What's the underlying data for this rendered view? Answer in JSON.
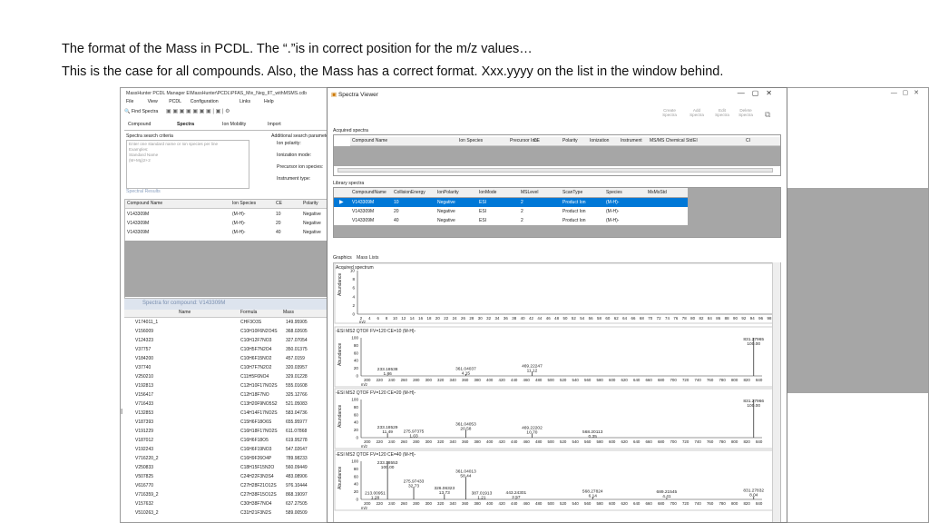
{
  "caption": {
    "line1": "The format of the Mass in PCDL. The “.”is in correct position for the m/z values…",
    "line2": "This is the case for all compounds. Also, the Mass has a correct format. Xxx.yyyy on the list in the window behind."
  },
  "back": {
    "title": "MassHunter PCDL Manager  E\\MassHunter\\PCDL\\PFAS_Mix_Neg_IIT_withMSMS.cdb",
    "menu": [
      "File",
      "View",
      "PCDL",
      "Configuration",
      "Links",
      "Help"
    ],
    "find_spectra": "Find Spectra",
    "tabs": [
      "Compound",
      "Spectra",
      "Ion Mobility",
      "Import"
    ],
    "criteria_title": "Spectra search criteria",
    "criteria_hint": [
      "Enter one standard name or Ion species per line",
      "Examples:",
      "Standard Name",
      "(M+Mg)2+2"
    ],
    "additional_title": "Additional search parameter",
    "params": [
      "Ion polarity:",
      "Ionization mode:",
      "Precursor ion species:",
      "Instrument type:"
    ],
    "results_title": "Spectral Results",
    "results_cols": [
      "Compound Name",
      "Ion Species",
      "CE",
      "Polarity"
    ],
    "results_rows": [
      [
        "V143309M",
        "(M-H)-",
        "10",
        "Negative"
      ],
      [
        "V143309M",
        "(M-H)-",
        "20",
        "Negative"
      ],
      [
        "V143309M",
        "(M-H)-",
        "40",
        "Negative"
      ]
    ],
    "compound_title": "Spectra for compound: V143309M",
    "list_cols": [
      "Name",
      "Formula",
      "Mass"
    ],
    "list_rows": [
      [
        "V174011_1",
        "CHF3O3S",
        "149.95905"
      ],
      [
        "V156009",
        "C10H10F6N2O4S",
        "368.02605"
      ],
      [
        "V124323",
        "C10H12F7NO3",
        "327.07054"
      ],
      [
        "V37757",
        "C10H5F7N2O4",
        "350.01375"
      ],
      [
        "V184200",
        "C10H6F15NO2",
        "457.0159"
      ],
      [
        "V37740",
        "C10H7F7N2O2",
        "320.03957"
      ],
      [
        "V250210",
        "C11H5F6NO4",
        "329.01228"
      ],
      [
        "V192813",
        "C12H10F17NO2S",
        "555.01608"
      ],
      [
        "V156417",
        "C12H18F7NO",
        "325.12766"
      ],
      [
        "V716433",
        "C13H20F9NO5S2",
        "521.05083"
      ],
      [
        "V132853",
        "C14H14F17NO2S",
        "583.04736"
      ],
      [
        "V187393",
        "C15H6F18O6S",
        "655.95977"
      ],
      [
        "V191229",
        "C16H18F17NO2S",
        "611.07868"
      ],
      [
        "V187012",
        "C16H6F18O5",
        "619.95278"
      ],
      [
        "V192243",
        "C16H6F19NO3",
        "547.02647"
      ],
      [
        "V716220_2",
        "C16H9F26O4P",
        "789.98233"
      ],
      [
        "V250833",
        "C18H15F15N2O",
        "560.09449"
      ],
      [
        "V507825",
        "C24H22F3N3S4",
        "483.08906"
      ],
      [
        "V616770",
        "C27H28F21O12S",
        "976.10444"
      ],
      [
        "V716359_2",
        "C27H38F15O12S",
        "868.19097"
      ],
      [
        "V157632",
        "C30H38F7NO4",
        "637.27505"
      ],
      [
        "V510263_2",
        "C31H21F3N2S",
        "589.00509"
      ]
    ]
  },
  "viewer": {
    "title": "Spectra Viewer",
    "toolbar": [
      "Create Spectra",
      "Add Spectra",
      "Edit Spectra",
      "Delete Spectra"
    ],
    "acquired_title": "Acquired spectra",
    "acquired_cols": [
      "Compound Name",
      "Ion Species",
      "Precursor Ion",
      "CE",
      "Polarity",
      "Ionization",
      "Instrument",
      "MS/MS Chemical Std",
      "EI",
      "CI"
    ],
    "library_title": "Library spectra",
    "library_cols": [
      "CompoundName",
      "CollisionEnergy",
      "IonPolarity",
      "IonMode",
      "MSLevel",
      "ScanType",
      "Species",
      "MsMsStd"
    ],
    "library_rows": [
      [
        "V143309M",
        "10",
        "Negative",
        "ESI",
        "2",
        "Product Ion",
        "(M-H)-"
      ],
      [
        "V143309M",
        "20",
        "Negative",
        "ESI",
        "2",
        "Product Ion",
        "(M-H)-"
      ],
      [
        "V143309M",
        "40",
        "Negative",
        "ESI",
        "2",
        "Product Ion",
        "(M-H)-"
      ]
    ],
    "graphics_tabs": [
      "Graphics",
      "Mass Lists"
    ],
    "acq_plot": {
      "label": "Acquired spectrum",
      "ylabel": "Abundance",
      "yticks": [
        "10",
        "8",
        "6",
        "4",
        "2",
        "0"
      ],
      "xticks": [
        "2",
        "4",
        "6",
        "8",
        "10",
        "12",
        "14",
        "16",
        "18",
        "20",
        "22",
        "24",
        "26",
        "28",
        "30",
        "32",
        "34",
        "36",
        "38",
        "40",
        "42",
        "44",
        "46",
        "48",
        "50",
        "52",
        "54",
        "56",
        "58",
        "60",
        "62",
        "64",
        "66",
        "68",
        "70",
        "72",
        "74",
        "76",
        "78",
        "80",
        "82",
        "84",
        "86",
        "88",
        "90",
        "92",
        "94",
        "96",
        "98"
      ],
      "xlabel": "m/z"
    },
    "spec_xticks": [
      "200",
      "220",
      "240",
      "260",
      "280",
      "300",
      "320",
      "340",
      "360",
      "380",
      "400",
      "420",
      "440",
      "460",
      "480",
      "500",
      "520",
      "540",
      "560",
      "580",
      "600",
      "620",
      "640",
      "660",
      "680",
      "700",
      "720",
      "740",
      "760",
      "780",
      "800",
      "820",
      "840"
    ],
    "spec_yticks": [
      "100",
      "80",
      "60",
      "40",
      "20",
      "0"
    ],
    "ylabel": "Abundance",
    "xlabel": "m/z",
    "panels": [
      {
        "title": "-ESI MS2 QTOF FV=120  CE=10 (M-H)-",
        "peaks": [
          [
            233.18538,
            1.86
          ],
          [
            361.04037,
            4.15
          ],
          [
            469.22247,
            11.12
          ],
          [
            831.27965,
            100
          ]
        ],
        "labels": [
          {
            "mz": "233.18538",
            "ab": "1.86"
          },
          {
            "mz": "361.04037",
            "ab": "4.15"
          },
          {
            "mz": "469.22247",
            "ab": "11.12"
          },
          {
            "mz": "831.27965",
            "ab": "100.00"
          }
        ]
      },
      {
        "title": "-ESI MS2 QTOF FV=120  CE=20 (M-H)-",
        "peaks": [
          [
            233.18529,
            11.49
          ],
          [
            275.97375,
            1.03
          ],
          [
            361.04053,
            20.58
          ],
          [
            469.22202,
            10.7
          ],
          [
            568.20113,
            0.35
          ],
          [
            831.27966,
            100
          ]
        ],
        "labels": [
          {
            "mz": "233.18529",
            "ab": "11.49"
          },
          {
            "mz": "275.97375",
            "ab": "1.03"
          },
          {
            "mz": "361.04053",
            "ab": "20.58"
          },
          {
            "mz": "469.22202",
            "ab": "10.70"
          },
          {
            "mz": "568.20113",
            "ab": "0.35"
          },
          {
            "mz": "831.27966",
            "ab": "100.00"
          }
        ]
      },
      {
        "title": "-ESI MS2 QTOF FV=120  CE=40 (M-H)-",
        "peaks": [
          [
            213.00951,
            1.28
          ],
          [
            233.18553,
            100
          ],
          [
            275.97433,
            32.73
          ],
          [
            326.06323,
            13.73
          ],
          [
            361.04013,
            58.44
          ],
          [
            387.01913,
            1.21
          ],
          [
            443.24301,
            2.57
          ],
          [
            568.27824,
            6.14
          ],
          [
            689.21545,
            4.41
          ],
          [
            831.27832,
            8.04
          ]
        ],
        "labels": [
          {
            "mz": "213.00951",
            "ab": "1.28"
          },
          {
            "mz": "233.18553",
            "ab": "100.00"
          },
          {
            "mz": "275.97433",
            "ab": "32.73"
          },
          {
            "mz": "326.06323",
            "ab": "13.73"
          },
          {
            "mz": "361.04013",
            "ab": "58.44"
          },
          {
            "mz": "387.01913",
            "ab": "1.21"
          },
          {
            "mz": "443.24301",
            "ab": "2.57"
          },
          {
            "mz": "568.27824",
            "ab": "6.14"
          },
          {
            "mz": "689.21545",
            "ab": "4.41"
          },
          {
            "mz": "831.27832",
            "ab": "8.04"
          }
        ]
      }
    ]
  }
}
